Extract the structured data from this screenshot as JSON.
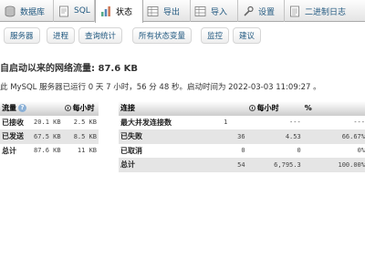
{
  "tabs": [
    {
      "label": "数据库",
      "icon": "database-icon"
    },
    {
      "label": "SQL",
      "icon": "sql-icon"
    },
    {
      "label": "状态",
      "icon": "status-icon"
    },
    {
      "label": "导出",
      "icon": "export-icon"
    },
    {
      "label": "导入",
      "icon": "import-icon"
    },
    {
      "label": "设置",
      "icon": "settings-icon"
    },
    {
      "label": "二进制日志",
      "icon": "binlog-icon"
    }
  ],
  "subnav": [
    "服务器",
    "进程",
    "查询统计",
    "所有状态变量",
    "监控",
    "建议"
  ],
  "heading": "自启动以来的网络流量: 87.6 KB",
  "info": "此 MySQL 服务器已运行 0 天 7 小时，56 分 48 秒。启动时间为 2022-03-03 11:09:27 。",
  "traffic": {
    "headers": [
      "流量",
      "每小时"
    ],
    "rows": [
      [
        "已接收",
        "20.1 KB",
        "2.5 KB"
      ],
      [
        "已发送",
        "67.5 KB",
        "8.5 KB"
      ],
      [
        "总计",
        "87.6 KB",
        "11 KB"
      ]
    ]
  },
  "connections": {
    "headers": [
      "连接",
      "",
      "每小时",
      "%"
    ],
    "rows": [
      [
        "最大并发连接数",
        "1",
        "---",
        "---"
      ],
      [
        "已失败",
        "36",
        "4.53",
        "66.67%"
      ],
      [
        "已取消",
        "0",
        "0",
        "0%"
      ],
      [
        "总计",
        "54",
        "6,795.3",
        "100.00%"
      ]
    ]
  }
}
